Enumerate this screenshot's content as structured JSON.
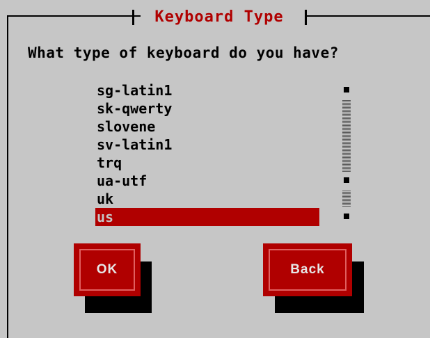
{
  "dialog": {
    "title": "Keyboard Type",
    "question": "What type of keyboard do you have?"
  },
  "keyboard_list": {
    "items": [
      "sg-latin1",
      "sk-qwerty",
      "slovene",
      "sv-latin1",
      "trq",
      "ua-utf",
      "uk",
      "us"
    ],
    "selected": "us"
  },
  "buttons": {
    "ok_label": "OK",
    "back_label": "Back"
  },
  "colors": {
    "background": "#c6c6c6",
    "accent": "#b00000",
    "shadow": "#000000"
  }
}
